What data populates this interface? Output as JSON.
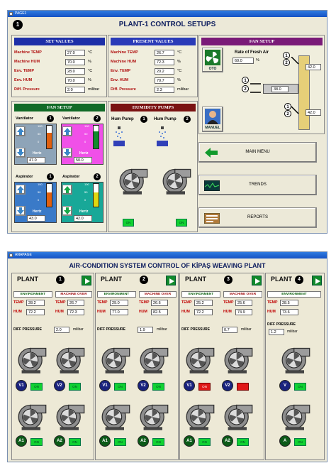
{
  "win1": {
    "title": "PAGE1",
    "heading": "PLANT-1 CONTROL SETUPS",
    "badge": "1",
    "set_values": {
      "header": "SET VALUES",
      "rows": [
        {
          "label": "Machine TEMP",
          "value": "27.0",
          "unit": "°C"
        },
        {
          "label": "Machine HUM",
          "value": "70.0",
          "unit": "%"
        },
        {
          "label": "Env. TEMP",
          "value": "28.0",
          "unit": "°C"
        },
        {
          "label": "Env. HUM",
          "value": "70.0",
          "unit": "%"
        },
        {
          "label": "Diff. Pressure",
          "value": "2.0",
          "unit": "milibar"
        }
      ]
    },
    "present_values": {
      "header": "PRESENT VALUES",
      "rows": [
        {
          "label": "Machine TEMP",
          "value": "26.7",
          "unit": "°C"
        },
        {
          "label": "Machine HUM",
          "value": "72.3",
          "unit": "%"
        },
        {
          "label": "Env. TEMP",
          "value": "20.2",
          "unit": "°C"
        },
        {
          "label": "Env. HUM",
          "value": "70.7",
          "unit": "%"
        },
        {
          "label": "Diff. Pressure",
          "value": "2.3",
          "unit": "milibar"
        }
      ]
    },
    "fan_setup_right": {
      "header": "FAN SETUP",
      "rate_label": "Rate of Fresh Air",
      "rate_value": "60.0",
      "rate_unit": "%",
      "oto_label": "OTO",
      "manuel_label": "MANUEL",
      "damper1": "42.0",
      "damper2": "38.0",
      "damper3": "42.0",
      "stage1": "1",
      "stage2": "2",
      "stage3": "1",
      "stage4": "2",
      "stage5": "1",
      "stage6": "2"
    },
    "fan_setup_left": {
      "header": "FAN SETUP",
      "vent1": {
        "label": "Vantilator",
        "num": "1",
        "ticks": [
          "100",
          "50",
          "0"
        ],
        "hertz": "Hertz",
        "value": "47.0"
      },
      "vent2": {
        "label": "Vantilator",
        "num": "2",
        "ticks": [
          "100",
          "50",
          "0"
        ],
        "hertz": "Hertz",
        "value": "50.0"
      },
      "asp1": {
        "label": "Aspirator",
        "num": "1",
        "ticks": [
          "100",
          "50",
          "0"
        ],
        "hertz": "Hertz",
        "value": "43.0"
      },
      "asp2": {
        "label": "Aspirator",
        "num": "2",
        "ticks": [
          "100",
          "50",
          "0"
        ],
        "hertz": "Hertz",
        "value": "42.0"
      }
    },
    "humidity": {
      "header": "HUMIDITY PUMPS",
      "pump1": "Hum Pump",
      "num1": "1",
      "pump2": "Hum Pump",
      "num2": "2",
      "on1": "ON",
      "on2": "ON"
    },
    "nav": {
      "main_menu": "MAIN MENU",
      "trends": "TRENDS",
      "reports": "REPORTS"
    }
  },
  "win2": {
    "title": "ANAPAGE",
    "heading": "AIR-CONDITION SYSTEM CONTROL OF KİPAŞ WEAVING PLANT",
    "diff_label": "DIFF PRESSURE",
    "milibar": "milibar",
    "plants": [
      {
        "name": "PLANT",
        "num": "1",
        "env": "ENVIRONMENT",
        "mach": "MACHINE OVER",
        "temp_label": "TEMP",
        "hum_label": "HUM",
        "env_temp": "28.2",
        "env_hum": "72.2",
        "mach_temp": "26.7",
        "mach_hum": "72.3",
        "diff": "2.0",
        "b1": "V1",
        "b2": "V2",
        "b3": "A1",
        "b4": "A2",
        "s1": "ON",
        "s2": "ON",
        "s3": "ON",
        "s4": "ON"
      },
      {
        "name": "PLANT",
        "num": "2",
        "env": "ENVIRONMENT",
        "mach": "MACHINE OVER",
        "temp_label": "TEMP",
        "hum_label": "HUM",
        "env_temp": "29.0",
        "env_hum": "77.0",
        "mach_temp": "26.6",
        "mach_hum": "82.5",
        "diff": "1.9",
        "b1": "V1",
        "b2": "V2",
        "b3": "A1",
        "b4": "A2",
        "s1": "ON",
        "s2": "ON",
        "s3": "ON",
        "s4": "ON"
      },
      {
        "name": "PLANT",
        "num": "3",
        "env": "ENVIRONMENT",
        "mach": "MACHINE OVER",
        "temp_label": "TEMP",
        "hum_label": "HUM",
        "env_temp": "25.2",
        "env_hum": "72.2",
        "mach_temp": "25.6",
        "mach_hum": "74.9",
        "diff": "0.7",
        "b1": "V1",
        "b2": "V2",
        "b3": "A1",
        "b4": "A2",
        "s1": "ON",
        "s2": "",
        "s3": "ON",
        "s4": "ON"
      },
      {
        "name": "PLANT",
        "num": "4",
        "env": "ENVIRONMENT",
        "temp_label": "TEMP",
        "hum_label": "HUM",
        "env_temp": "28.5",
        "env_hum": "73.6",
        "diff": "1.2",
        "b1": "V",
        "b3": "A",
        "s1": "ON",
        "s3": "ON"
      }
    ]
  }
}
